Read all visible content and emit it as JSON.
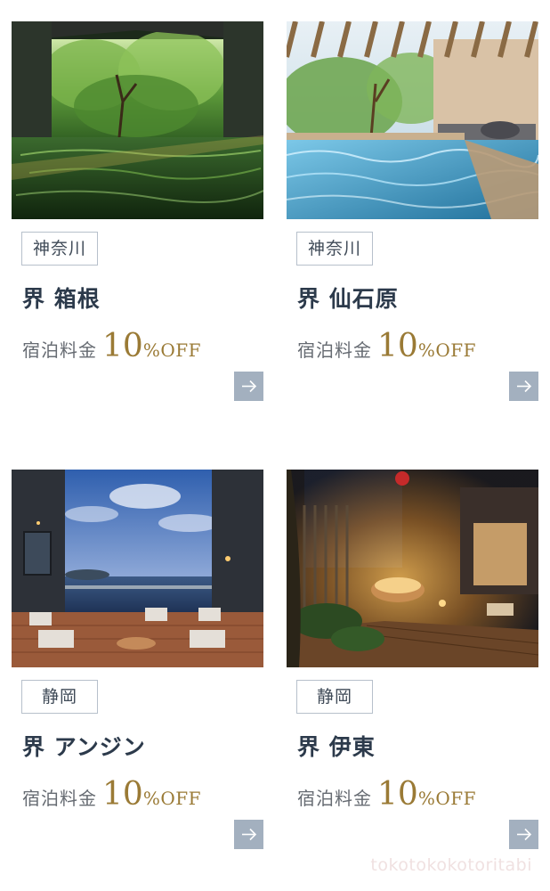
{
  "cards": [
    {
      "region": "神奈川",
      "name": "界 箱根",
      "price_label": "宿泊料金",
      "discount_value": "10",
      "discount_unit": "%OFF",
      "photo_icon": "onsen-forest-photo",
      "link_icon": "arrow-right-icon"
    },
    {
      "region": "神奈川",
      "name": "界 仙石原",
      "price_label": "宿泊料金",
      "discount_value": "10",
      "discount_unit": "%OFF",
      "photo_icon": "open-air-bath-photo",
      "link_icon": "arrow-right-icon"
    },
    {
      "region": "静岡",
      "name": "界 アンジン",
      "price_label": "宿泊料金",
      "discount_value": "10",
      "discount_unit": "%OFF",
      "photo_icon": "ocean-terrace-photo",
      "link_icon": "arrow-right-icon"
    },
    {
      "region": "静岡",
      "name": "界 伊東",
      "price_label": "宿泊料金",
      "discount_value": "10",
      "discount_unit": "%OFF",
      "photo_icon": "night-garden-bath-photo",
      "link_icon": "arrow-right-icon"
    }
  ],
  "colors": {
    "discount_gold": "#9a7a35",
    "name_navy": "#2c3a4b",
    "region_border": "#b7c0cb",
    "button_bg": "#a3b0bf"
  },
  "watermark": "tokotokokotoritabi"
}
